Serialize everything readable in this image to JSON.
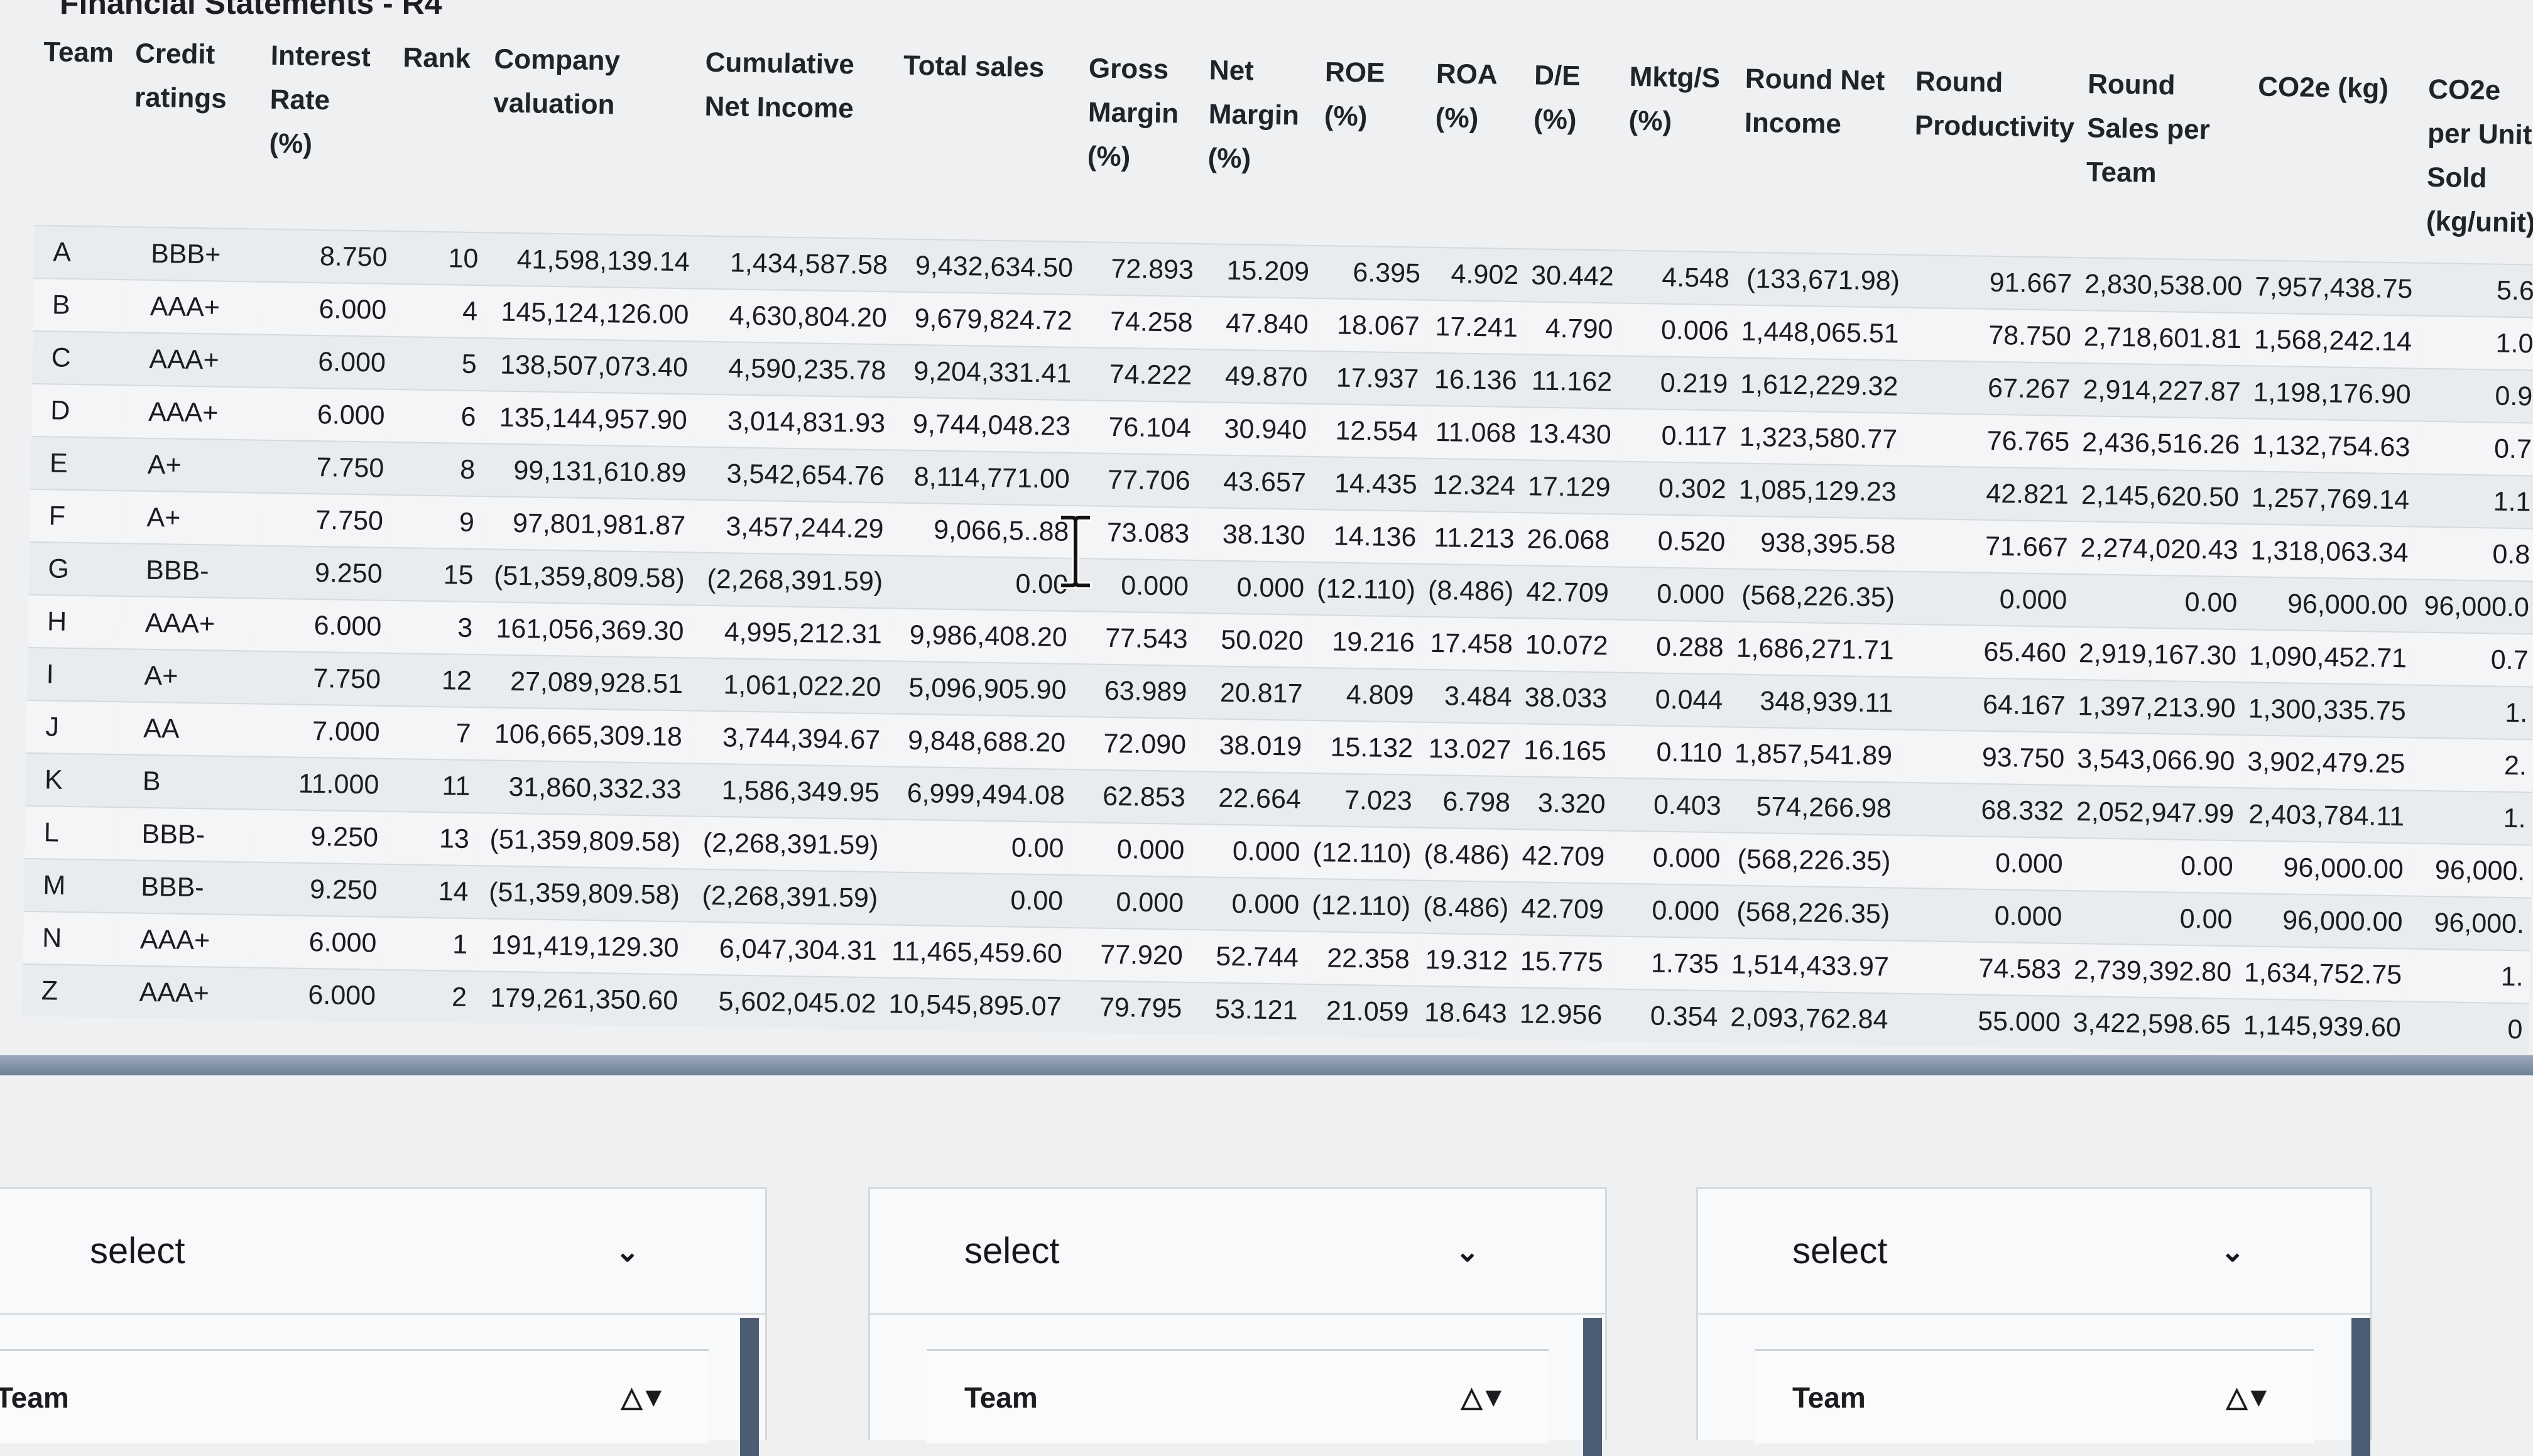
{
  "title": "Financial Statements - R4",
  "columns": [
    [
      "Team"
    ],
    [
      "Credit",
      "ratings"
    ],
    [
      "Interest",
      "Rate",
      "(%)"
    ],
    [
      "Rank"
    ],
    [
      "Company",
      "valuation"
    ],
    [
      "Cumulative",
      "Net Income"
    ],
    [
      "Total sales"
    ],
    [
      "Gross",
      "Margin",
      "(%)"
    ],
    [
      "Net",
      "Margin",
      "(%)"
    ],
    [
      "ROE",
      "(%)"
    ],
    [
      "ROA",
      "(%)"
    ],
    [
      "D/E",
      "(%)"
    ],
    [
      "Mktg/S",
      "(%)"
    ],
    [
      "Round Net",
      "Income"
    ],
    [
      "Round",
      "Productivity"
    ],
    [
      "Round",
      "Sales per",
      "Team"
    ],
    [
      "CO2e (kg)"
    ],
    [
      "CO2e",
      "per Unit",
      "Sold",
      "(kg/unit)"
    ]
  ],
  "rows": [
    [
      "A",
      "BBB+",
      "8.750",
      "10",
      "41,598,139.14",
      "1,434,587.58",
      "9,432,634.50",
      "72.893",
      "15.209",
      "6.395",
      "4.902",
      "30.442",
      "4.548",
      "(133,671.98)",
      "91.667",
      "2,830,538.00",
      "7,957,438.75",
      "5.6"
    ],
    [
      "B",
      "AAA+",
      "6.000",
      "4",
      "145,124,126.00",
      "4,630,804.20",
      "9,679,824.72",
      "74.258",
      "47.840",
      "18.067",
      "17.241",
      "4.790",
      "0.006",
      "1,448,065.51",
      "78.750",
      "2,718,601.81",
      "1,568,242.14",
      "1.0"
    ],
    [
      "C",
      "AAA+",
      "6.000",
      "5",
      "138,507,073.40",
      "4,590,235.78",
      "9,204,331.41",
      "74.222",
      "49.870",
      "17.937",
      "16.136",
      "11.162",
      "0.219",
      "1,612,229.32",
      "67.267",
      "2,914,227.87",
      "1,198,176.90",
      "0.9"
    ],
    [
      "D",
      "AAA+",
      "6.000",
      "6",
      "135,144,957.90",
      "3,014,831.93",
      "9,744,048.23",
      "76.104",
      "30.940",
      "12.554",
      "11.068",
      "13.430",
      "0.117",
      "1,323,580.77",
      "76.765",
      "2,436,516.26",
      "1,132,754.63",
      "0.7"
    ],
    [
      "E",
      "A+",
      "7.750",
      "8",
      "99,131,610.89",
      "3,542,654.76",
      "8,114,771.00",
      "77.706",
      "43.657",
      "14.435",
      "12.324",
      "17.129",
      "0.302",
      "1,085,129.23",
      "42.821",
      "2,145,620.50",
      "1,257,769.14",
      "1.1"
    ],
    [
      "F",
      "A+",
      "7.750",
      "9",
      "97,801,981.87",
      "3,457,244.29",
      "9,066,5..88",
      "73.083",
      "38.130",
      "14.136",
      "11.213",
      "26.068",
      "0.520",
      "938,395.58",
      "71.667",
      "2,274,020.43",
      "1,318,063.34",
      "0.8"
    ],
    [
      "G",
      "BBB-",
      "9.250",
      "15",
      "(51,359,809.58)",
      "(2,268,391.59)",
      "0.00",
      "0.000",
      "0.000",
      "(12.110)",
      "(8.486)",
      "42.709",
      "0.000",
      "(568,226.35)",
      "0.000",
      "0.00",
      "96,000.00",
      "96,000.0"
    ],
    [
      "H",
      "AAA+",
      "6.000",
      "3",
      "161,056,369.30",
      "4,995,212.31",
      "9,986,408.20",
      "77.543",
      "50.020",
      "19.216",
      "17.458",
      "10.072",
      "0.288",
      "1,686,271.71",
      "65.460",
      "2,919,167.30",
      "1,090,452.71",
      "0.7"
    ],
    [
      "I",
      "A+",
      "7.750",
      "12",
      "27,089,928.51",
      "1,061,022.20",
      "5,096,905.90",
      "63.989",
      "20.817",
      "4.809",
      "3.484",
      "38.033",
      "0.044",
      "348,939.11",
      "64.167",
      "1,397,213.90",
      "1,300,335.75",
      "1."
    ],
    [
      "J",
      "AA",
      "7.000",
      "7",
      "106,665,309.18",
      "3,744,394.67",
      "9,848,688.20",
      "72.090",
      "38.019",
      "15.132",
      "13.027",
      "16.165",
      "0.110",
      "1,857,541.89",
      "93.750",
      "3,543,066.90",
      "3,902,479.25",
      "2."
    ],
    [
      "K",
      "B",
      "11.000",
      "11",
      "31,860,332.33",
      "1,586,349.95",
      "6,999,494.08",
      "62.853",
      "22.664",
      "7.023",
      "6.798",
      "3.320",
      "0.403",
      "574,266.98",
      "68.332",
      "2,052,947.99",
      "2,403,784.11",
      "1."
    ],
    [
      "L",
      "BBB-",
      "9.250",
      "13",
      "(51,359,809.58)",
      "(2,268,391.59)",
      "0.00",
      "0.000",
      "0.000",
      "(12.110)",
      "(8.486)",
      "42.709",
      "0.000",
      "(568,226.35)",
      "0.000",
      "0.00",
      "96,000.00",
      "96,000."
    ],
    [
      "M",
      "BBB-",
      "9.250",
      "14",
      "(51,359,809.58)",
      "(2,268,391.59)",
      "0.00",
      "0.000",
      "0.000",
      "(12.110)",
      "(8.486)",
      "42.709",
      "0.000",
      "(568,226.35)",
      "0.000",
      "0.00",
      "96,000.00",
      "96,000."
    ],
    [
      "N",
      "AAA+",
      "6.000",
      "1",
      "191,419,129.30",
      "6,047,304.31",
      "11,465,459.60",
      "77.920",
      "52.744",
      "22.358",
      "19.312",
      "15.775",
      "1.735",
      "1,514,433.97",
      "74.583",
      "2,739,392.80",
      "1,634,752.75",
      "1."
    ],
    [
      "Z",
      "AAA+",
      "6.000",
      "2",
      "179,261,350.60",
      "5,602,045.02",
      "10,545,895.07",
      "79.795",
      "53.121",
      "21.059",
      "18.643",
      "12.956",
      "0.354",
      "2,093,762.84",
      "55.000",
      "3,422,598.65",
      "1,145,939.60",
      "0"
    ]
  ],
  "filters": [
    {
      "select_label": "select",
      "list_header": "Team",
      "sort_icons": "△▼"
    },
    {
      "select_label": "select",
      "list_header": "Team",
      "sort_icons": "△▼"
    },
    {
      "select_label": "select",
      "list_header": "Team",
      "sort_icons": "△▼"
    }
  ]
}
